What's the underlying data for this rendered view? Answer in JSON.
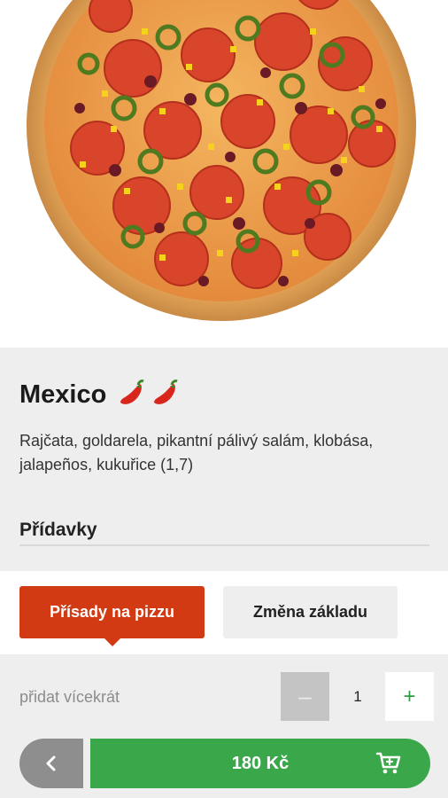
{
  "product": {
    "name": "Mexico",
    "ingredients": "Rajčata, goldarela, pikantní pálivý salám, klobása, jalapeños, kukuřice (1,7)",
    "spiciness": 2
  },
  "extras": {
    "section_title": "Přídavky"
  },
  "tabs": [
    {
      "label": "Přísady na pizzu",
      "active": true
    },
    {
      "label": "Změna základu",
      "active": false
    }
  ],
  "quantity": {
    "label": "přidat vícekrát",
    "value": "1",
    "minus_label": "–",
    "plus_label": "+"
  },
  "order": {
    "price_label": "180 Kč"
  },
  "icons": {
    "back": "chevron-left-icon",
    "cart": "cart-icon",
    "spice": "chili-pepper-icon"
  },
  "colors": {
    "accent_red": "#d13a13",
    "accent_green": "#3aa84a",
    "plus_green": "#2f9b47"
  }
}
